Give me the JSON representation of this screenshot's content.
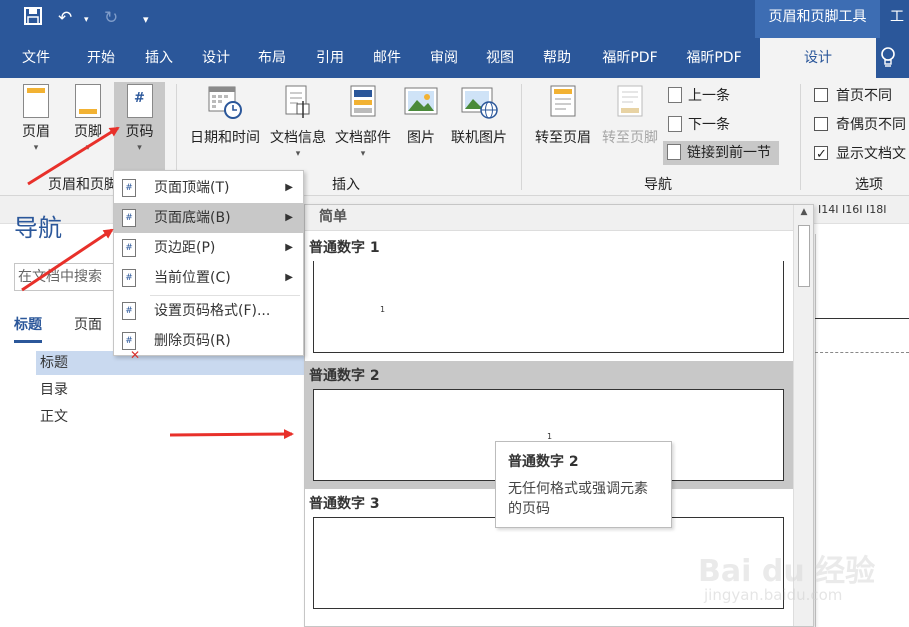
{
  "titlebar": {
    "context_tool": "页眉和页脚工具",
    "extra": "工"
  },
  "tabs": [
    {
      "label": "文件"
    },
    {
      "label": "开始"
    },
    {
      "label": "插入"
    },
    {
      "label": "设计"
    },
    {
      "label": "布局"
    },
    {
      "label": "引用"
    },
    {
      "label": "邮件"
    },
    {
      "label": "审阅"
    },
    {
      "label": "视图"
    },
    {
      "label": "帮助"
    },
    {
      "label": "福昕PDF"
    },
    {
      "label": "福昕PDF"
    },
    {
      "label": "设计"
    }
  ],
  "ribbon": {
    "header_group": {
      "header": "页眉",
      "footer": "页脚",
      "page_number": "页码",
      "label": "页眉和页脚"
    },
    "insert_group": {
      "date_time": "日期和时间",
      "doc_info": "文档信息",
      "doc_parts": "文档部件",
      "picture": "图片",
      "online_picture": "联机图片",
      "label": "插入"
    },
    "nav_group": {
      "goto_header": "转至页眉",
      "goto_footer": "转至页脚",
      "previous": "上一条",
      "next": "下一条",
      "link_previous": "链接到前一节",
      "label": "导航"
    },
    "options_group": {
      "first_page_diff": "首页不同",
      "odd_even_diff": "奇偶页不同",
      "show_doc_text": "显示文档文",
      "label": "选项"
    }
  },
  "navigation": {
    "title": "导航",
    "search_placeholder": "在文档中搜索",
    "tab_headings": "标题",
    "tab_pages": "页面",
    "headings": [
      "标题",
      "目录",
      "正文"
    ]
  },
  "ruler": {
    "text": "I14I  I16I  I18I"
  },
  "page_number_menu": [
    {
      "label": "页面顶端(T)",
      "has_sub": true
    },
    {
      "label": "页面底端(B)",
      "has_sub": true
    },
    {
      "label": "页边距(P)",
      "has_sub": true
    },
    {
      "label": "当前位置(C)",
      "has_sub": true
    },
    {
      "label": "设置页码格式(F)...",
      "has_sub": false
    },
    {
      "label": "删除页码(R)",
      "has_sub": false
    }
  ],
  "gallery": {
    "section": "简单",
    "items": [
      {
        "label": "普通数字 1",
        "number": "1"
      },
      {
        "label": "普通数字 2",
        "number": "1"
      },
      {
        "label": "普通数字 3",
        "number": ""
      }
    ]
  },
  "tooltip": {
    "title": "普通数字 2",
    "body": "无任何格式或强调元素的页码"
  },
  "watermark": {
    "main": "Bai du 经验",
    "sub": "jingyan.baidu.com"
  },
  "colors": {
    "brand": "#2b579a",
    "annotation_arrow": "#e8302a"
  }
}
